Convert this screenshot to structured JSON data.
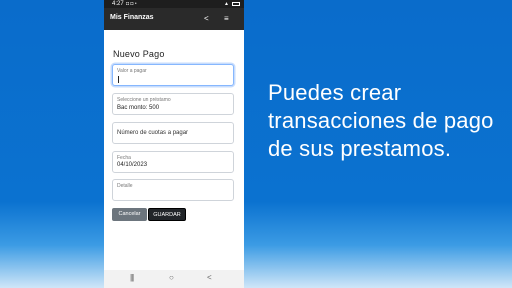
{
  "status_bar": {
    "time": "4:27",
    "status_icons": "◘ ◘ •"
  },
  "app_bar": {
    "title": "Mis Finanzas"
  },
  "form": {
    "title": "Nuevo Pago",
    "amount": {
      "placeholder": "Valor a pagar"
    },
    "loan": {
      "label": "Seleccione un préstamo",
      "value": "Bac monto: 500"
    },
    "installments": {
      "placeholder": "Número de cuotas a pagar"
    },
    "date": {
      "label": "Fecha",
      "value": "04/10/2023"
    },
    "detail": {
      "placeholder": "Detalle"
    },
    "cancel_label": "Cancelar",
    "save_label": "GUARDAR"
  },
  "caption": "Puedes crear transacciones de pago de sus prestamos.",
  "colors": {
    "background": "#0a6ccb",
    "app_bar": "#2a2a2a",
    "cancel": "#6c757d",
    "save": "#212529"
  },
  "icons": [
    "share-icon",
    "hamburger-menu-icon",
    "recents-icon",
    "home-icon",
    "back-icon",
    "battery-icon",
    "signal-icon"
  ]
}
